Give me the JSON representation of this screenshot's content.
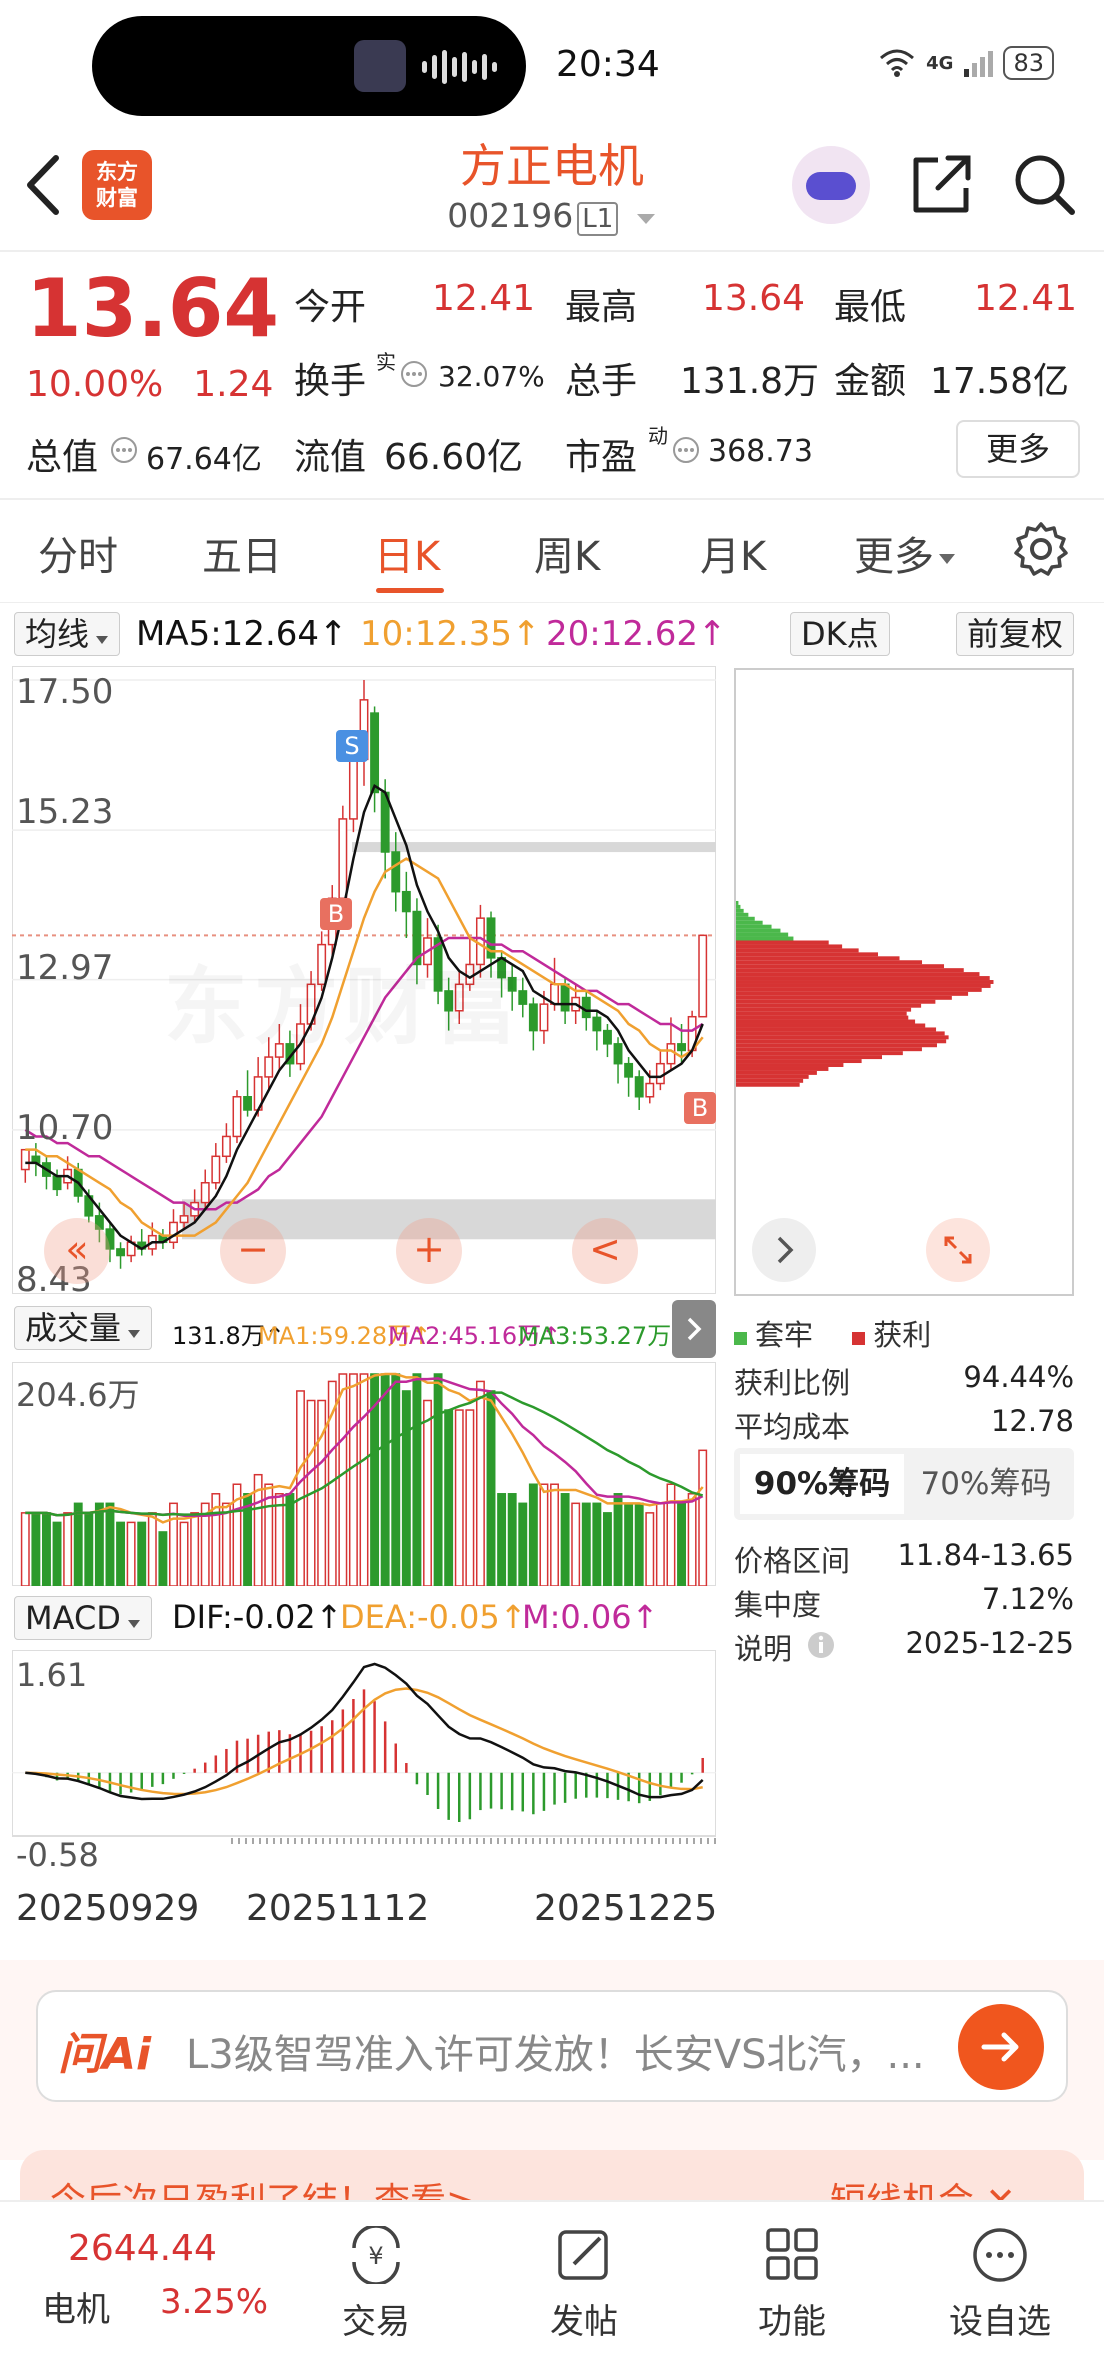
{
  "status_bar": {
    "time": "20:34",
    "battery": "83",
    "network": "4G"
  },
  "header": {
    "app_logo": "东方\n财富",
    "stock_name": "方正电机",
    "stock_code": "002196",
    "level": "L1"
  },
  "quote": {
    "price": "13.64",
    "change_pct": "10.00%",
    "change_amt": "1.24",
    "open_label": "今开",
    "open": "12.41",
    "high_label": "最高",
    "high": "13.64",
    "low_label": "最低",
    "low": "12.41",
    "turnover_label": "换手",
    "turnover_sup": "实",
    "turnover": "32.07%",
    "volume_label": "总手",
    "volume": "131.8万",
    "amount_label": "金额",
    "amount": "17.58亿",
    "mktcap_label": "总值",
    "mktcap": "67.64亿",
    "float_label": "流值",
    "float": "66.60亿",
    "pe_label": "市盈",
    "pe_sup": "动",
    "pe": "368.73",
    "more_label": "更多"
  },
  "tabs": [
    "分时",
    "五日",
    "日K",
    "周K",
    "月K",
    "更多"
  ],
  "active_tab": "日K",
  "kline": {
    "ind_label": "均线",
    "ma5": "MA5:12.64↑",
    "ma10": "10:12.35↑",
    "ma20": "20:12.62↑",
    "dk_label": "DK点",
    "adjust_label": "前复权",
    "y_labels": [
      "17.50",
      "15.23",
      "12.97",
      "10.70",
      "8.43"
    ],
    "marker_s": "S",
    "marker_b": "B",
    "controls": [
      "−",
      "+",
      "<"
    ],
    "watermark": "东方财富"
  },
  "volume": {
    "label": "成交量",
    "value": "131.8万↑",
    "ma1": "MA1:59.28万↑",
    "ma2": "MA2:45.16万↑",
    "ma3": "MA3:53.27万↑",
    "y_label": "204.6万"
  },
  "macd": {
    "label": "MACD",
    "dif": "DIF:-0.02↑",
    "dea": "DEA:-0.05↑",
    "m": "M:0.06↑",
    "y_top": "1.61",
    "y_bottom": "-0.58"
  },
  "dates": [
    "20250929",
    "20251112",
    "20251225"
  ],
  "chips": {
    "legend_trapped": "套牢",
    "legend_profit": "获利",
    "rows": [
      {
        "label": "获利比例",
        "value": "94.44%"
      },
      {
        "label": "平均成本",
        "value": "12.78"
      }
    ],
    "seg_a": "90%筹码",
    "seg_b": "70%筹码",
    "rows2": [
      {
        "label": "价格区间",
        "value": "11.84-13.65"
      },
      {
        "label": "集中度",
        "value": "7.12%"
      },
      {
        "label": "说明",
        "value": "2025-12-25"
      }
    ]
  },
  "ai": {
    "logo": "问Ai",
    "text": "L3级智驾准入许可发放！长安VS北汽，..."
  },
  "promo": {
    "text": "今后次日盈利了结！查看>",
    "right": "短线机会 ✕"
  },
  "bottom_nav": {
    "index_value": "2644.44",
    "index_name": "电机",
    "index_pct": "3.25%",
    "items": [
      "交易",
      "发帖",
      "功能",
      "设自选"
    ]
  },
  "colors": {
    "accent": "#e8542a",
    "up": "#d63333",
    "down": "#2c9a2c",
    "ma5": "#111111",
    "ma10": "#f0a030",
    "ma20": "#c02a9a"
  },
  "chart_data": {
    "type": "candlestick",
    "ylim": [
      8.43,
      17.5
    ],
    "candles": [
      [
        10.1,
        10.4,
        10.4,
        9.9
      ],
      [
        10.3,
        10.2,
        10.5,
        10.0
      ],
      [
        10.2,
        10.0,
        10.3,
        9.8
      ],
      [
        10.0,
        9.8,
        10.1,
        9.7
      ],
      [
        9.9,
        10.1,
        10.3,
        9.8
      ],
      [
        10.1,
        9.7,
        10.2,
        9.6
      ],
      [
        9.7,
        9.4,
        9.8,
        9.3
      ],
      [
        9.4,
        9.2,
        9.6,
        9.0
      ],
      [
        9.2,
        8.9,
        9.3,
        8.7
      ],
      [
        8.9,
        8.8,
        9.0,
        8.6
      ],
      [
        8.8,
        9.0,
        9.1,
        8.7
      ],
      [
        9.0,
        8.9,
        9.2,
        8.8
      ],
      [
        8.9,
        9.1,
        9.3,
        8.8
      ],
      [
        9.1,
        9.0,
        9.2,
        8.9
      ],
      [
        9.0,
        9.3,
        9.5,
        8.9
      ],
      [
        9.3,
        9.4,
        9.6,
        9.2
      ],
      [
        9.4,
        9.6,
        9.8,
        9.3
      ],
      [
        9.6,
        9.9,
        10.1,
        9.5
      ],
      [
        9.9,
        10.3,
        10.5,
        9.8
      ],
      [
        10.3,
        10.6,
        10.8,
        10.2
      ],
      [
        10.6,
        11.2,
        11.3,
        10.5
      ],
      [
        11.2,
        11.0,
        11.6,
        10.9
      ],
      [
        11.0,
        11.5,
        11.8,
        10.9
      ],
      [
        11.5,
        11.8,
        12.1,
        11.3
      ],
      [
        11.8,
        12.0,
        12.3,
        11.6
      ],
      [
        12.0,
        11.7,
        12.2,
        11.5
      ],
      [
        11.7,
        12.3,
        12.6,
        11.6
      ],
      [
        12.3,
        12.9,
        13.1,
        12.2
      ],
      [
        12.9,
        13.5,
        13.7,
        12.8
      ],
      [
        13.5,
        14.2,
        14.4,
        13.3
      ],
      [
        14.2,
        15.4,
        15.6,
        14.0
      ],
      [
        15.4,
        16.3,
        16.6,
        15.2
      ],
      [
        16.3,
        17.2,
        17.5,
        15.9
      ],
      [
        17.0,
        15.8,
        17.1,
        15.5
      ],
      [
        15.8,
        14.9,
        16.0,
        14.5
      ],
      [
        14.9,
        14.3,
        15.2,
        14.0
      ],
      [
        14.3,
        14.0,
        14.6,
        13.6
      ],
      [
        14.0,
        13.2,
        14.2,
        12.9
      ],
      [
        13.2,
        13.6,
        13.9,
        13.0
      ],
      [
        13.6,
        12.8,
        13.8,
        12.6
      ],
      [
        12.8,
        12.5,
        13.0,
        12.2
      ],
      [
        12.5,
        12.9,
        13.1,
        12.3
      ],
      [
        12.9,
        13.2,
        13.6,
        12.8
      ],
      [
        13.2,
        13.9,
        14.1,
        13.0
      ],
      [
        13.9,
        13.3,
        14.0,
        13.0
      ],
      [
        13.3,
        13.0,
        13.4,
        12.7
      ],
      [
        13.0,
        12.8,
        13.2,
        12.5
      ],
      [
        12.8,
        12.6,
        13.0,
        12.4
      ],
      [
        12.6,
        12.2,
        12.7,
        11.9
      ],
      [
        12.2,
        12.6,
        12.8,
        12.0
      ],
      [
        12.6,
        12.9,
        13.3,
        12.5
      ],
      [
        12.9,
        12.5,
        13.0,
        12.3
      ],
      [
        12.5,
        12.7,
        12.9,
        12.3
      ],
      [
        12.7,
        12.4,
        12.8,
        12.2
      ],
      [
        12.4,
        12.2,
        12.5,
        11.9
      ],
      [
        12.2,
        12.0,
        12.3,
        11.8
      ],
      [
        12.0,
        11.7,
        12.1,
        11.4
      ],
      [
        11.7,
        11.5,
        11.8,
        11.2
      ],
      [
        11.5,
        11.2,
        11.6,
        11.0
      ],
      [
        11.2,
        11.4,
        11.6,
        11.1
      ],
      [
        11.4,
        11.7,
        11.9,
        11.3
      ],
      [
        11.7,
        12.0,
        12.4,
        11.6
      ],
      [
        12.0,
        11.9,
        12.3,
        11.7
      ],
      [
        11.9,
        12.41,
        12.5,
        11.8
      ],
      [
        12.41,
        13.64,
        13.64,
        12.41
      ]
    ],
    "ma5": [
      10.2,
      10.2,
      10.1,
      10.0,
      10.0,
      9.9,
      9.7,
      9.5,
      9.3,
      9.1,
      9.0,
      8.9,
      9.0,
      9.0,
      9.1,
      9.2,
      9.3,
      9.5,
      9.7,
      10.0,
      10.4,
      10.7,
      11.0,
      11.3,
      11.6,
      11.8,
      12.0,
      12.3,
      12.7,
      13.3,
      14.0,
      14.8,
      15.5,
      15.9,
      15.8,
      15.4,
      15.0,
      14.4,
      14.0,
      13.7,
      13.3,
      13.1,
      13.0,
      13.1,
      13.2,
      13.3,
      13.2,
      13.1,
      12.8,
      12.7,
      12.6,
      12.6,
      12.6,
      12.5,
      12.5,
      12.4,
      12.2,
      11.9,
      11.7,
      11.5,
      11.5,
      11.6,
      11.7,
      11.9,
      12.3
    ],
    "ma10": [
      10.4,
      10.4,
      10.3,
      10.3,
      10.2,
      10.1,
      10.0,
      9.9,
      9.8,
      9.6,
      9.5,
      9.3,
      9.2,
      9.1,
      9.1,
      9.1,
      9.1,
      9.2,
      9.3,
      9.5,
      9.7,
      9.9,
      10.2,
      10.5,
      10.8,
      11.1,
      11.4,
      11.7,
      12.0,
      12.4,
      12.9,
      13.4,
      13.9,
      14.3,
      14.6,
      14.7,
      14.8,
      14.7,
      14.6,
      14.5,
      14.2,
      13.9,
      13.6,
      13.5,
      13.4,
      13.4,
      13.3,
      13.2,
      13.1,
      13.0,
      12.9,
      12.9,
      12.8,
      12.8,
      12.7,
      12.6,
      12.5,
      12.3,
      12.2,
      12.0,
      11.9,
      11.9,
      11.8,
      11.9,
      12.1
    ],
    "ma20": [
      10.7,
      10.6,
      10.6,
      10.5,
      10.5,
      10.4,
      10.3,
      10.3,
      10.2,
      10.1,
      10.0,
      9.9,
      9.8,
      9.7,
      9.6,
      9.6,
      9.5,
      9.5,
      9.5,
      9.6,
      9.6,
      9.7,
      9.8,
      10.0,
      10.1,
      10.3,
      10.5,
      10.7,
      10.9,
      11.2,
      11.5,
      11.8,
      12.1,
      12.4,
      12.7,
      12.9,
      13.1,
      13.3,
      13.4,
      13.5,
      13.6,
      13.6,
      13.6,
      13.6,
      13.5,
      13.5,
      13.4,
      13.4,
      13.3,
      13.2,
      13.1,
      13.0,
      12.9,
      12.8,
      12.8,
      12.7,
      12.6,
      12.6,
      12.5,
      12.4,
      12.3,
      12.3,
      12.2,
      12.2,
      12.3
    ]
  }
}
